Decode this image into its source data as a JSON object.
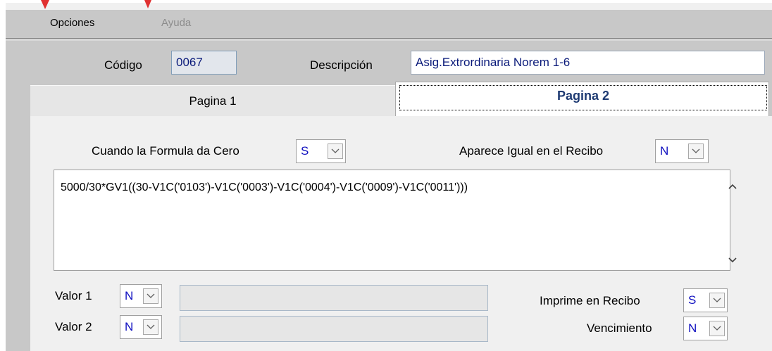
{
  "menu": {
    "opciones_label": "Opciones",
    "ayuda_label": "Ayuda"
  },
  "header": {
    "codigo_label": "Código",
    "codigo_value": "0067",
    "descripcion_label": "Descripción",
    "descripcion_value": "Asig.Extrordinaria Norem 1-6"
  },
  "tabs": [
    {
      "label": "Pagina 1",
      "active": false
    },
    {
      "label": "Pagina 2",
      "active": true
    }
  ],
  "page2": {
    "cuando_cero_label": "Cuando la Formula da Cero",
    "cuando_cero_value": "S",
    "aparece_igual_label": "Aparece Igual en el Recibo",
    "aparece_igual_value": "N",
    "formula": "5000/30*GV1((30-V1C('0103')-V1C('0003')-V1C('0004')-V1C('0009')-V1C('0011')))",
    "valor1_label": "Valor 1",
    "valor1_value": "N",
    "valor2_label": "Valor 2",
    "valor2_value": "N",
    "imprime_label": "Imprime en Recibo",
    "imprime_value": "S",
    "vencimiento_label": "Vencimiento",
    "vencimiento_value": "N"
  },
  "icons": {
    "dropdown": "chevron-down-icon",
    "scroll_up": "chevron-up-icon",
    "scroll_down": "chevron-down-icon"
  },
  "colors": {
    "field_text": "#0a1a7a",
    "select_text": "#1010c0",
    "active_tab_text": "#1f3b73"
  }
}
